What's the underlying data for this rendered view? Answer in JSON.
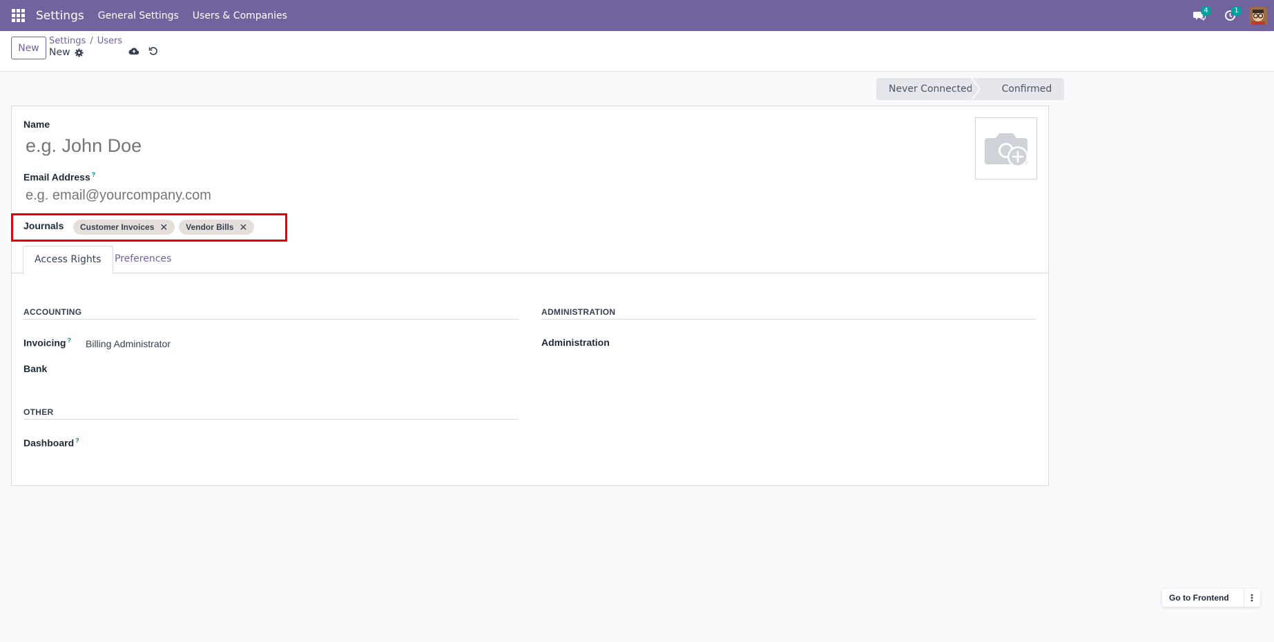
{
  "navbar": {
    "brand": "Settings",
    "menus": [
      "General Settings",
      "Users & Companies"
    ],
    "messages_count": "4",
    "activities_count": "1"
  },
  "control_panel": {
    "new_button": "New",
    "breadcrumb_parent": "Settings",
    "breadcrumb_sep": "/",
    "breadcrumb_current": "Users",
    "record_name": "New"
  },
  "statusbar": {
    "steps": [
      "Never Connected",
      "Confirmed"
    ]
  },
  "form": {
    "name_label": "Name",
    "name_placeholder": "e.g. John Doe",
    "email_label": "Email Address",
    "email_help": "?",
    "email_placeholder": "e.g. email@yourcompany.com",
    "journals_label": "Journals",
    "journal_tags": [
      "Customer Invoices",
      "Vendor Bills"
    ],
    "tabs": [
      "Access Rights",
      "Preferences"
    ],
    "accounting_title": "ACCOUNTING",
    "administration_title": "ADMINISTRATION",
    "invoicing_label": "Invoicing",
    "invoicing_value": "Billing Administrator",
    "bank_label": "Bank",
    "administration_label": "Administration",
    "other_title": "OTHER",
    "dashboard_label": "Dashboard"
  },
  "floating": {
    "go_to_frontend": "Go to Frontend"
  },
  "colors": {
    "brand": "#71639e",
    "highlight": "#e3000b",
    "badge": "#00a09d"
  }
}
